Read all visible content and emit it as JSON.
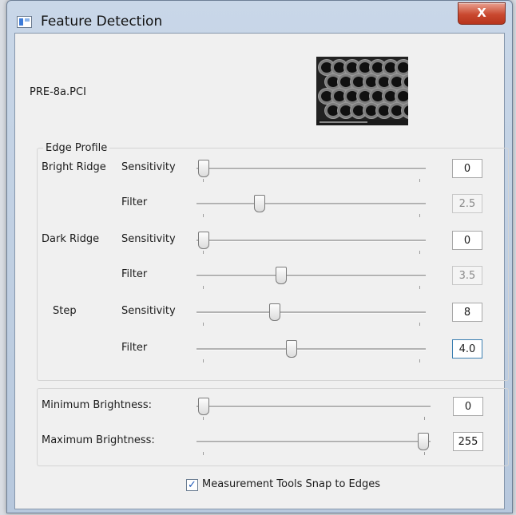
{
  "window": {
    "title": "Feature Detection",
    "close_glyph": "X"
  },
  "file": {
    "name": "PRE-8a.PCI"
  },
  "edge_profile": {
    "group_label": "Edge Profile",
    "rows": [
      {
        "section": "Bright Ridge",
        "param": "Sensitivity",
        "value": "0",
        "slider_fraction": 0.0,
        "enabled": true
      },
      {
        "section": "",
        "param": "Filter",
        "value": "2.5",
        "slider_fraction": 0.26,
        "enabled": false
      },
      {
        "section": "Dark Ridge",
        "param": "Sensitivity",
        "value": "0",
        "slider_fraction": 0.0,
        "enabled": true
      },
      {
        "section": "",
        "param": "Filter",
        "value": "3.5",
        "slider_fraction": 0.36,
        "enabled": false
      },
      {
        "section": "Step",
        "param": "Sensitivity",
        "value": "8",
        "slider_fraction": 0.33,
        "enabled": true
      },
      {
        "section": "",
        "param": "Filter",
        "value": "4.0",
        "slider_fraction": 0.41,
        "enabled": true,
        "focused": true
      }
    ]
  },
  "brightness": {
    "rows": [
      {
        "label": "Minimum Brightness:",
        "value": "0",
        "slider_fraction": 0.0
      },
      {
        "label": "Maximum Brightness:",
        "value": "255",
        "slider_fraction": 1.0
      }
    ]
  },
  "snap": {
    "label": "Measurement Tools Snap to Edges",
    "checked": true,
    "check_glyph": "✓"
  }
}
